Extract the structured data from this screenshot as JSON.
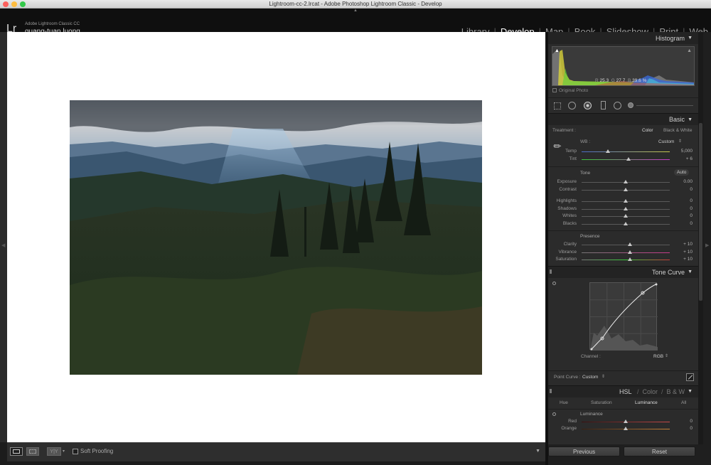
{
  "window": {
    "title": "Lightroom-cc-2.lrcat - Adobe Photoshop Lightroom Classic - Develop"
  },
  "identity": {
    "logo": "Lr",
    "app_name": "Adobe Lightroom Classic CC",
    "user": "quang-tuan luong"
  },
  "modules": [
    "Library",
    "Develop",
    "Map",
    "Book",
    "Slideshow",
    "Print",
    "Web"
  ],
  "active_module": "Develop",
  "toolbar": {
    "soft_proofing": "Soft Proofing"
  },
  "histogram": {
    "title": "Histogram",
    "r_label": "R",
    "r": "25.3",
    "g_label": "G",
    "g": "27.7",
    "b_label": "B",
    "b": "39.6",
    "unit": "%",
    "original_photo": "Original Photo"
  },
  "basic": {
    "title": "Basic",
    "treatment_label": "Treatment :",
    "treatment_color": "Color",
    "treatment_bw": "Black & White",
    "wb_label": "WB :",
    "wb_value": "Custom",
    "temp": {
      "label": "Temp",
      "value": "5,000",
      "pos": 0.3
    },
    "tint": {
      "label": "Tint",
      "value": "+ 6",
      "pos": 0.53
    },
    "tone_label": "Tone",
    "auto": "Auto",
    "exposure": {
      "label": "Exposure",
      "value": "0.00",
      "pos": 0.5
    },
    "contrast": {
      "label": "Contrast",
      "value": "0",
      "pos": 0.5
    },
    "highlights": {
      "label": "Highlights",
      "value": "0",
      "pos": 0.5
    },
    "shadows": {
      "label": "Shadows",
      "value": "0",
      "pos": 0.5
    },
    "whites": {
      "label": "Whites",
      "value": "0",
      "pos": 0.5
    },
    "blacks": {
      "label": "Blacks",
      "value": "0",
      "pos": 0.5
    },
    "presence_label": "Presence",
    "clarity": {
      "label": "Clarity",
      "value": "+ 10",
      "pos": 0.55
    },
    "vibrance": {
      "label": "Vibrance",
      "value": "+ 10",
      "pos": 0.55
    },
    "saturation": {
      "label": "Saturation",
      "value": "+ 10",
      "pos": 0.55
    }
  },
  "tone_curve": {
    "title": "Tone Curve",
    "channel_label": "Channel :",
    "channel_value": "RGB",
    "point_curve_label": "Point Curve :",
    "point_curve_value": "Custom"
  },
  "hsl": {
    "title": "HSL",
    "title_color": "Color",
    "title_bw": "B & W",
    "separator": "/",
    "tabs": [
      "Hue",
      "Saturation",
      "Luminance",
      "All"
    ],
    "active_tab": "Luminance",
    "section": "Luminance",
    "red": {
      "label": "Red",
      "value": "0",
      "pos": 0.5
    },
    "orange": {
      "label": "Orange",
      "value": "0",
      "pos": 0.5
    }
  },
  "buttons": {
    "previous": "Previous",
    "reset": "Reset"
  },
  "colors": {
    "accent_text": "#ffffff",
    "panel_bg": "#2b2b2b",
    "topbar_bg": "#0f0f0f"
  }
}
